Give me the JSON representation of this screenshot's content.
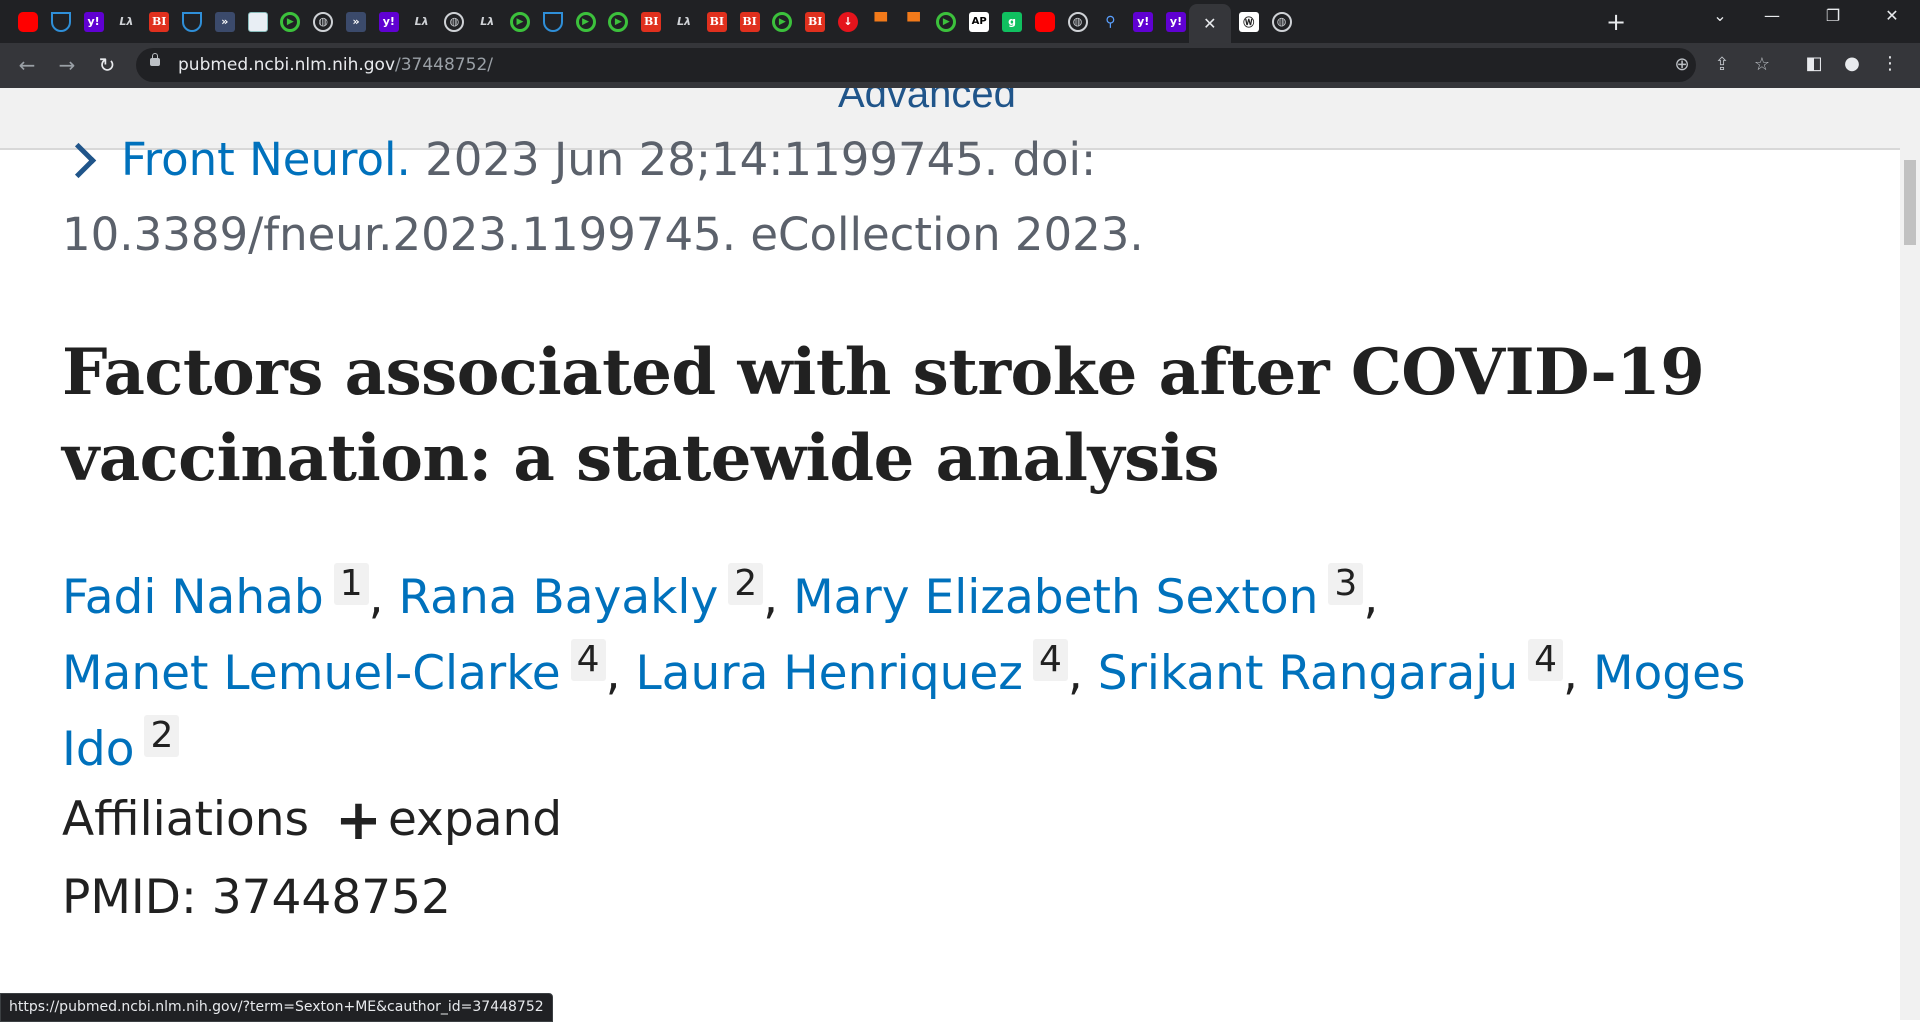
{
  "browser": {
    "tabs": [
      {
        "icon": "youtube-icon"
      },
      {
        "icon": "shield-icon"
      },
      {
        "icon": "yahoo-icon",
        "text": "y!"
      },
      {
        "icon": "mw-icon",
        "text": "Lλ"
      },
      {
        "icon": "bi-icon",
        "text": "BI"
      },
      {
        "icon": "shield-icon"
      },
      {
        "icon": "arrow-icon"
      },
      {
        "icon": "grid-icon"
      },
      {
        "icon": "play-icon"
      },
      {
        "icon": "globe-icon"
      },
      {
        "icon": "arrow-icon"
      },
      {
        "icon": "yahoo-icon",
        "text": "y!"
      },
      {
        "icon": "mw-icon",
        "text": "Lλ"
      },
      {
        "icon": "globe-icon"
      },
      {
        "icon": "mw-icon",
        "text": "Lλ"
      },
      {
        "icon": "play-icon"
      },
      {
        "icon": "shield-icon"
      },
      {
        "icon": "play-icon"
      },
      {
        "icon": "play-icon"
      },
      {
        "icon": "bi-icon",
        "text": "BI"
      },
      {
        "icon": "mw-icon",
        "text": "Lλ"
      },
      {
        "icon": "bi-icon",
        "text": "BI"
      },
      {
        "icon": "bi-icon",
        "text": "BI"
      },
      {
        "icon": "play-icon"
      },
      {
        "icon": "bi-icon",
        "text": "BI"
      },
      {
        "icon": "download-icon"
      },
      {
        "icon": "bookmark-icon"
      },
      {
        "icon": "bookmark-icon"
      },
      {
        "icon": "play-icon"
      },
      {
        "icon": "ap-icon",
        "text": "AP"
      },
      {
        "icon": "g-icon",
        "text": "g"
      },
      {
        "icon": "youtube-icon"
      },
      {
        "icon": "globe-icon"
      },
      {
        "icon": "search-icon"
      },
      {
        "icon": "yahoo-icon",
        "text": "y!"
      },
      {
        "icon": "yahoo-icon",
        "text": "y!"
      },
      {
        "icon": "close-icon",
        "active": true
      },
      {
        "icon": "wp-icon",
        "text": "Ⓦ"
      },
      {
        "icon": "globe-icon"
      }
    ],
    "url_domain": "pubmed.ncbi.nlm.nih.gov",
    "url_path": "/37448752/",
    "status_url": "https://pubmed.ncbi.nlm.nih.gov/?term=Sexton+ME&cauthor_id=37448752"
  },
  "search": {
    "advanced_label": "Advanced"
  },
  "article": {
    "journal": "Front Neurol.",
    "citation_rest": " 2023 Jun 28;14:1199745. doi: 10.3389/fneur.2023.1199745. eCollection 2023.",
    "title": "Factors associated with stroke after COVID-19 vaccination: a statewide analysis",
    "authors": [
      {
        "name": "Fadi Nahab",
        "aff": "1"
      },
      {
        "name": "Rana Bayakly",
        "aff": "2"
      },
      {
        "name": "Mary Elizabeth Sexton",
        "aff": "3"
      },
      {
        "name": "Manet Lemuel-Clarke",
        "aff": "4"
      },
      {
        "name": "Laura Henriquez",
        "aff": "4"
      },
      {
        "name": "Srikant Rangaraju",
        "aff": "4"
      },
      {
        "name": "Moges Ido",
        "aff": "2"
      }
    ],
    "separator": ",",
    "affiliations_label": "Affiliations",
    "expand_label": "expand",
    "pmid": "PMID: 37448752"
  },
  "colors": {
    "link": "#0071bc",
    "text": "#212121",
    "muted": "#5b616b"
  }
}
